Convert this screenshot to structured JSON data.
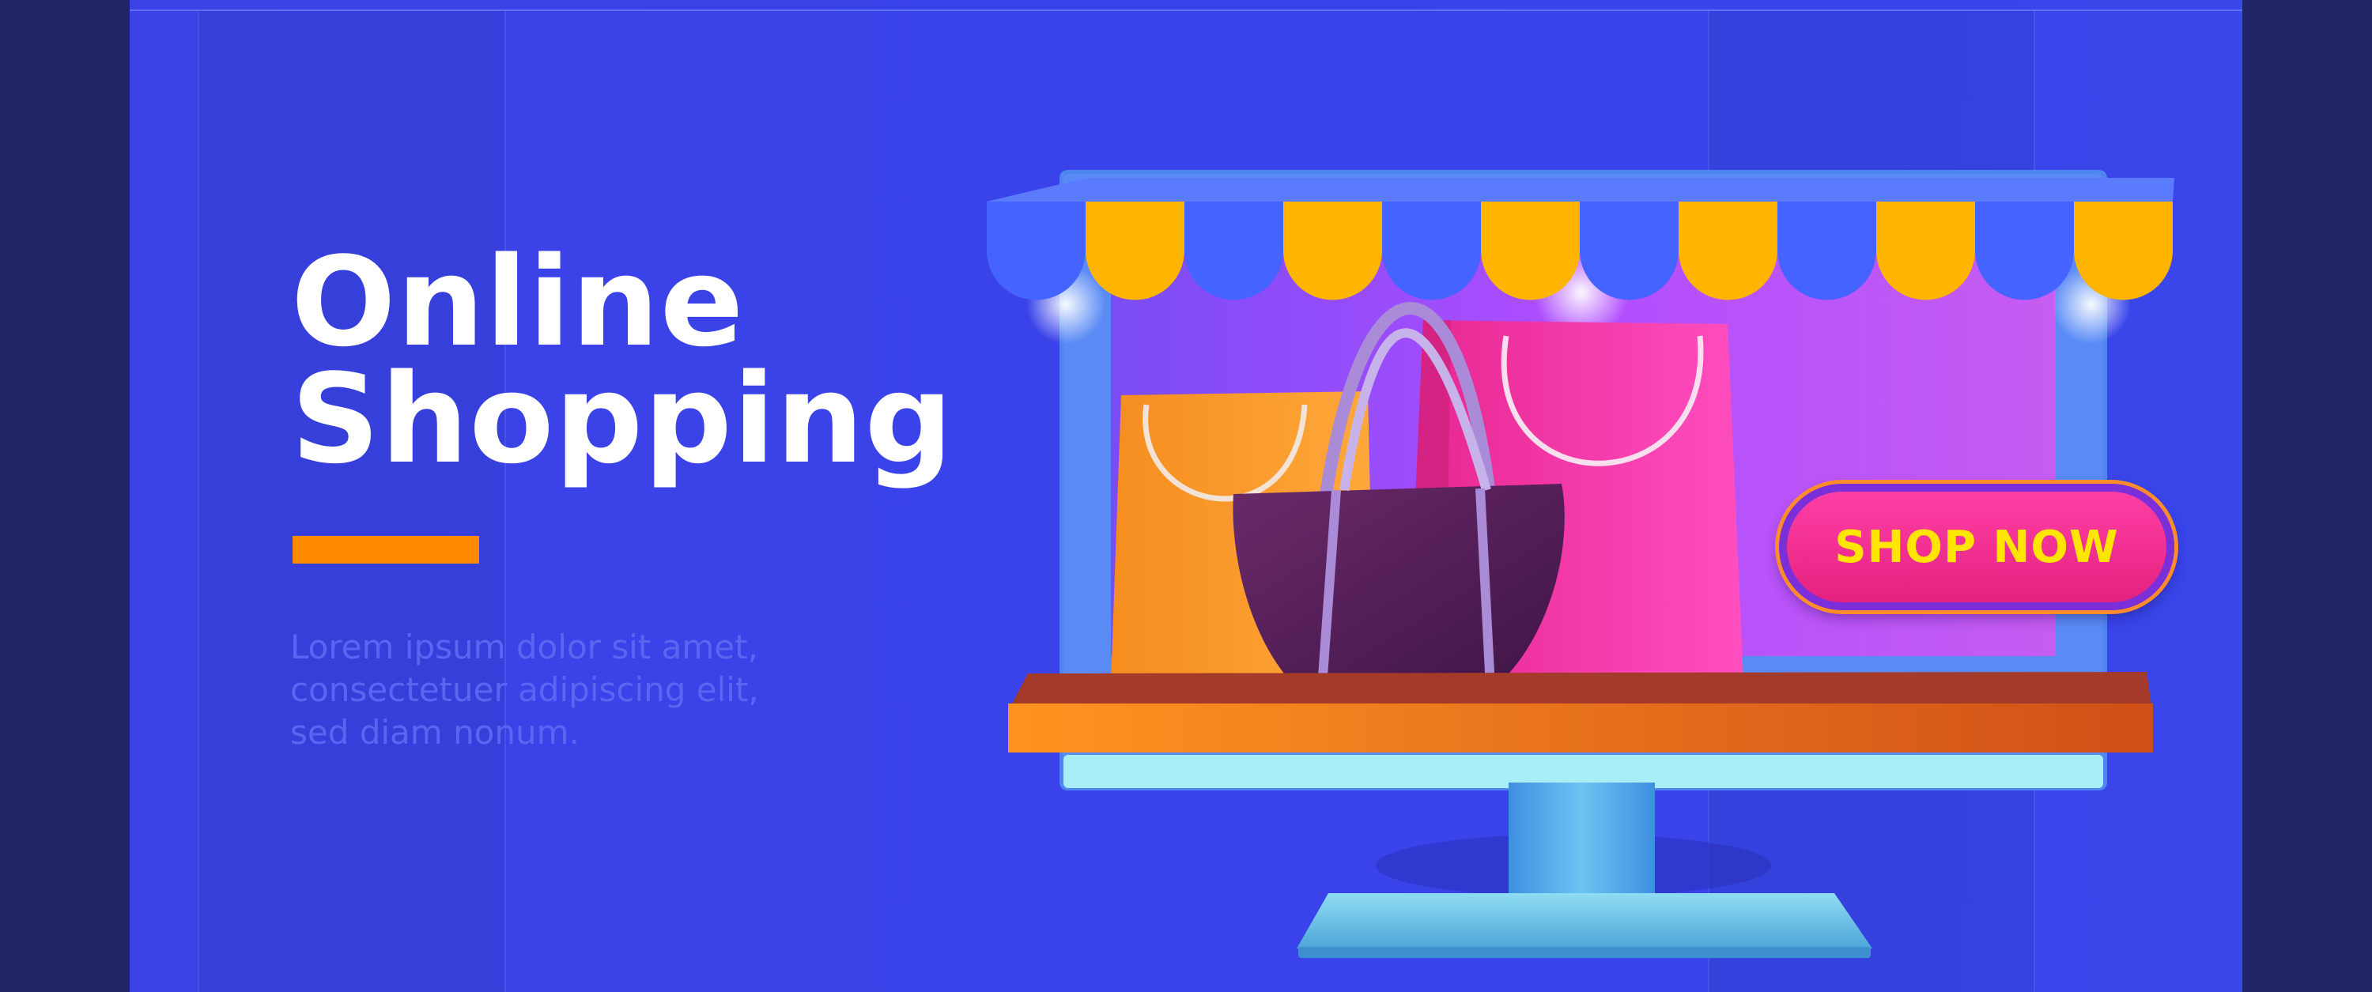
{
  "hero": {
    "title_line1": "Online",
    "title_line2": "Shopping",
    "body_line1": "Lorem ipsum dolor sit amet,",
    "body_line2": "consectetuer adipiscing elit,",
    "body_line3": "sed diam nonum."
  },
  "cta": {
    "label": "SHOP NOW"
  },
  "colors": {
    "background": "#3b42e6",
    "outer": "#1f2566",
    "accent_orange": "#ff8a00",
    "awning_blue": "#4563ff",
    "awning_yellow": "#ffb400",
    "button_pink": "#ff3fa6",
    "button_text": "#ffe600",
    "screen_purple": "#b14dff"
  },
  "icons": [
    "shopping-bag-icon",
    "handbag-icon",
    "awning-icon",
    "monitor-icon"
  ]
}
